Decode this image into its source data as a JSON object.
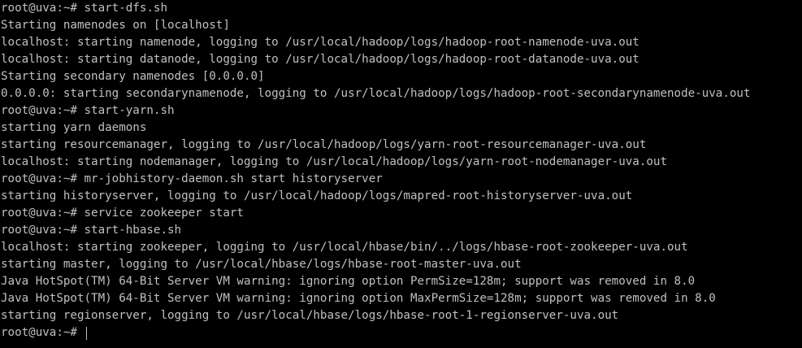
{
  "terminal": {
    "colors": {
      "background": "#000000",
      "foreground": "#c0c0c0"
    },
    "lines": [
      "root@uva:~# start-dfs.sh",
      "Starting namenodes on [localhost]",
      "localhost: starting namenode, logging to /usr/local/hadoop/logs/hadoop-root-namenode-uva.out",
      "localhost: starting datanode, logging to /usr/local/hadoop/logs/hadoop-root-datanode-uva.out",
      "Starting secondary namenodes [0.0.0.0]",
      "0.0.0.0: starting secondarynamenode, logging to /usr/local/hadoop/logs/hadoop-root-secondarynamenode-uva.out",
      "root@uva:~# start-yarn.sh",
      "starting yarn daemons",
      "starting resourcemanager, logging to /usr/local/hadoop/logs/yarn-root-resourcemanager-uva.out",
      "localhost: starting nodemanager, logging to /usr/local/hadoop/logs/yarn-root-nodemanager-uva.out",
      "root@uva:~# mr-jobhistory-daemon.sh start historyserver",
      "starting historyserver, logging to /usr/local/hadoop/logs/mapred-root-historyserver-uva.out",
      "root@uva:~# service zookeeper start",
      "root@uva:~# start-hbase.sh",
      "localhost: starting zookeeper, logging to /usr/local/hbase/bin/../logs/hbase-root-zookeeper-uva.out",
      "starting master, logging to /usr/local/hbase/logs/hbase-root-master-uva.out",
      "Java HotSpot(TM) 64-Bit Server VM warning: ignoring option PermSize=128m; support was removed in 8.0",
      "Java HotSpot(TM) 64-Bit Server VM warning: ignoring option MaxPermSize=128m; support was removed in 8.0",
      "starting regionserver, logging to /usr/local/hbase/logs/hbase-root-1-regionserver-uva.out"
    ],
    "prompt": "root@uva:~# "
  }
}
